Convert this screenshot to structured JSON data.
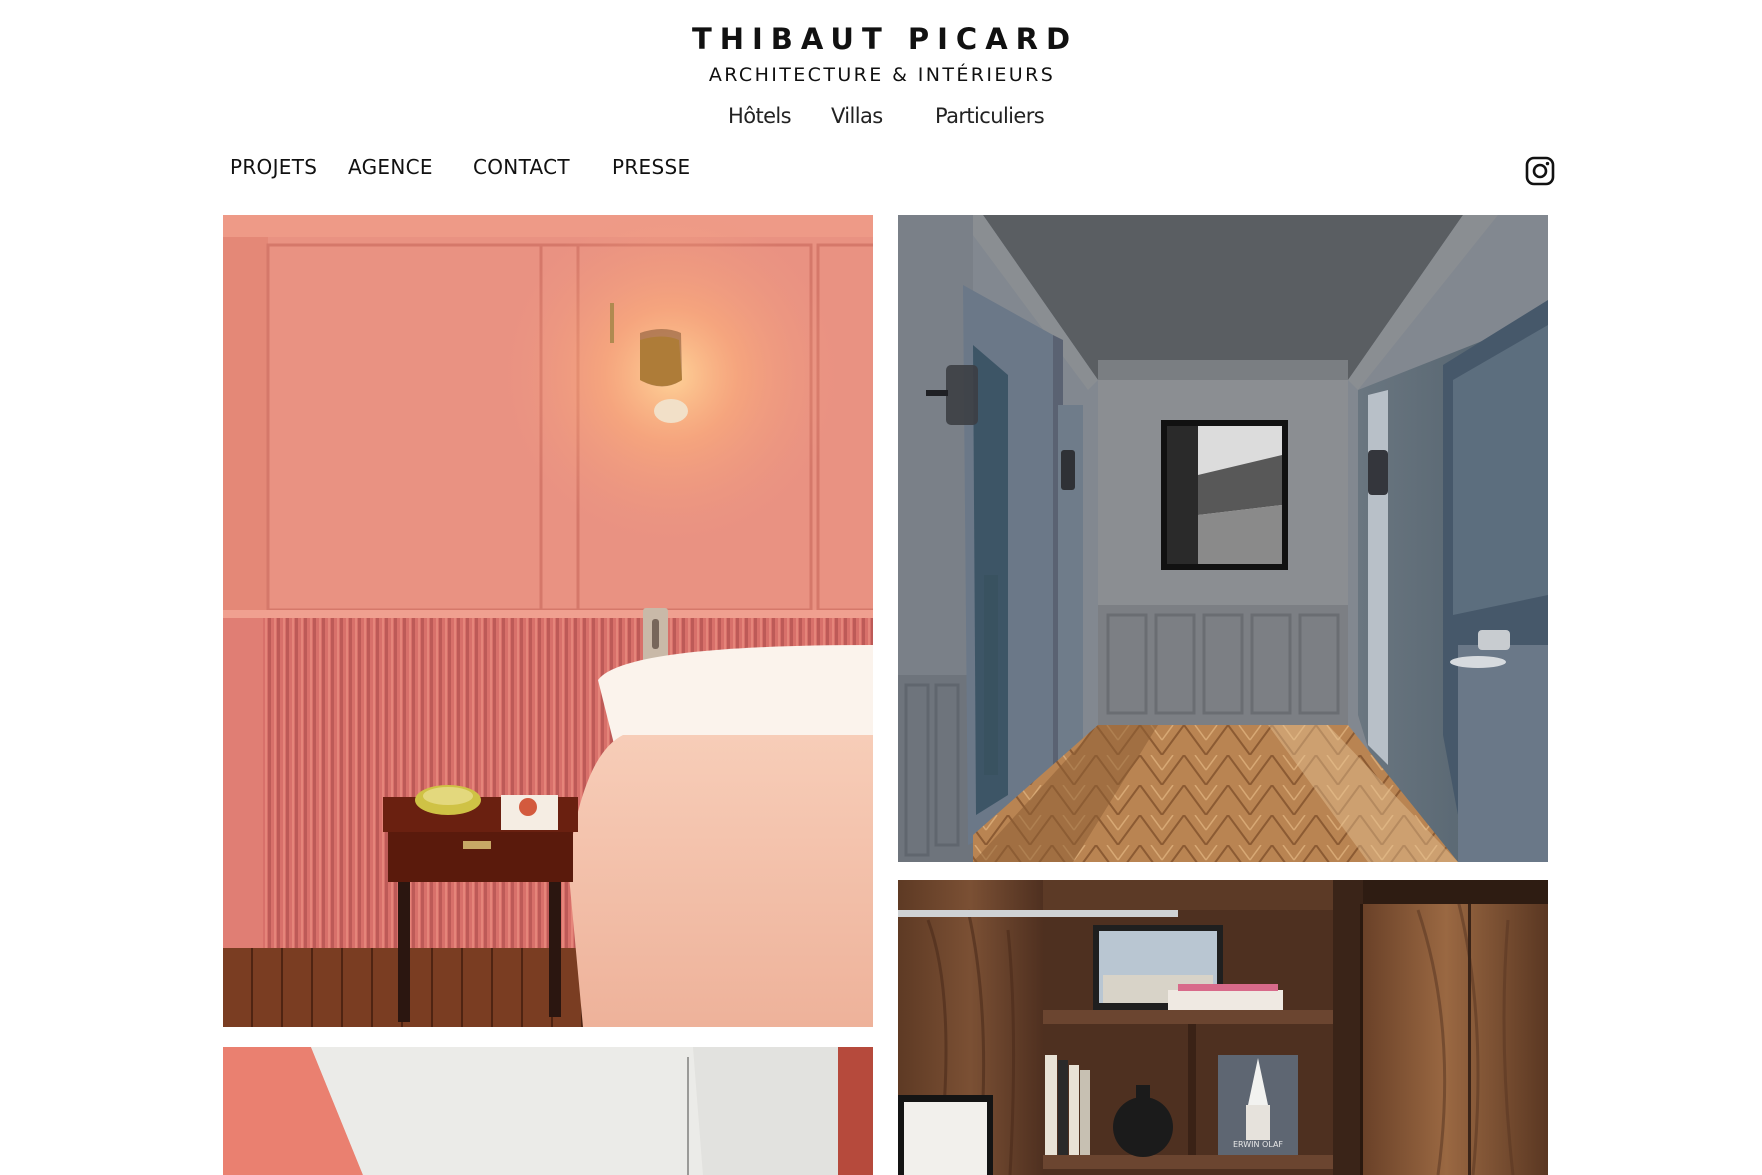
{
  "brand": {
    "title": "THIBAUT PICARD",
    "subtitle": "ARCHITECTURE & INTÉRIEURS"
  },
  "categories": [
    {
      "label": "Hôtels"
    },
    {
      "label": "Villas"
    },
    {
      "label": "Particuliers"
    }
  ],
  "nav": [
    {
      "label": "PROJETS"
    },
    {
      "label": "AGENCE"
    },
    {
      "label": "CONTACT"
    },
    {
      "label": "PRESSE"
    }
  ],
  "social": {
    "icon": "instagram-icon"
  },
  "gallery": {
    "photos": [
      {
        "subject": "pink bedroom with wall sconce"
      },
      {
        "subject": "grey hallway with herringbone parquet"
      },
      {
        "subject": "pink and white room, partially visible"
      },
      {
        "subject": "walnut shelving unit"
      }
    ],
    "shelf_book_text": "ERWIN OLAF"
  },
  "colors": {
    "background": "#ffffff",
    "text": "#111111",
    "pink_wall": "#e8907c",
    "grey_wall": "#7e858e",
    "walnut": "#5e3a24"
  }
}
